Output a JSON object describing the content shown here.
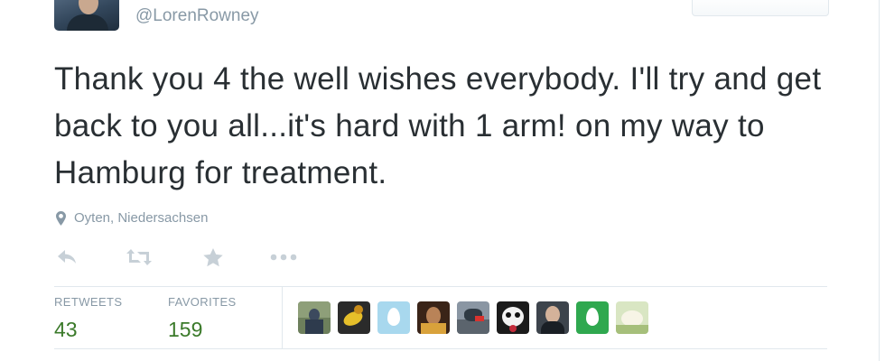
{
  "tweet": {
    "handle": "@LorenRowney",
    "text": "Thank you 4 the well wishes everybody. I'll try and get back to you all...it's hard with 1 arm! on my way to Hamburg for treatment.",
    "location": "Oyten, Niedersachsen"
  },
  "actions": [
    {
      "name": "reply",
      "icon": "reply-icon"
    },
    {
      "name": "retweet",
      "icon": "retweet-icon"
    },
    {
      "name": "favorite",
      "icon": "star-icon"
    },
    {
      "name": "more",
      "icon": "more-dots-icon"
    }
  ],
  "stats": {
    "retweets_label": "RETWEETS",
    "retweets_count": "43",
    "favorites_label": "FAVORITES",
    "favorites_count": "159"
  },
  "favoriters": [
    {
      "name": "favoriter-1",
      "color": "#6d7f5c"
    },
    {
      "name": "favoriter-2",
      "color": "#c9a227"
    },
    {
      "name": "favoriter-3",
      "color": "#bfe3f3"
    },
    {
      "name": "favoriter-4",
      "color": "#4a2e1e"
    },
    {
      "name": "favoriter-5",
      "color": "#7d8894"
    },
    {
      "name": "favoriter-6",
      "color": "#c22b3a"
    },
    {
      "name": "favoriter-7",
      "color": "#5e6670"
    },
    {
      "name": "favoriter-8",
      "color": "#34a853"
    },
    {
      "name": "favoriter-9",
      "color": "#cfe0b2"
    }
  ],
  "colors": {
    "text": "#292f33",
    "muted": "#8899a6",
    "count_green": "#3b7a2a",
    "divider": "#e1e8ed"
  }
}
